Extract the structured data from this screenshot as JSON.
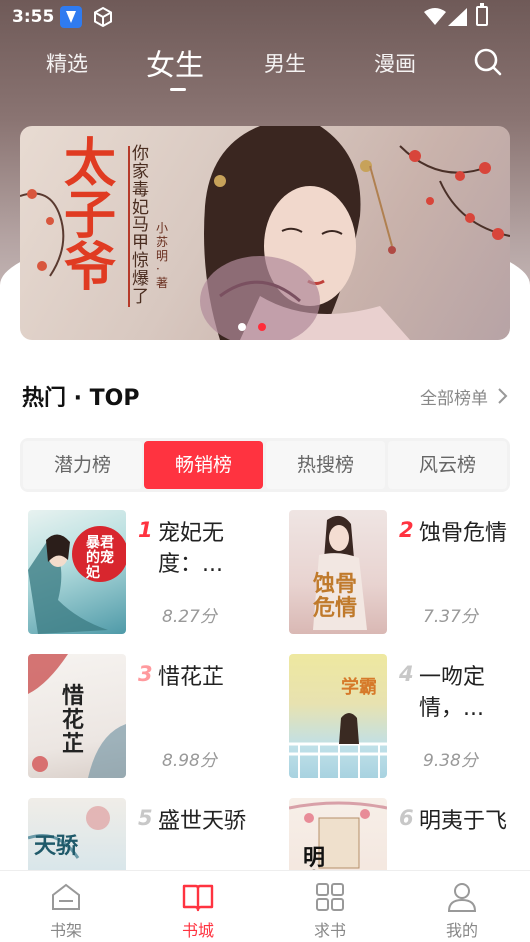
{
  "status_bar": {
    "time": "3:55"
  },
  "top_nav": {
    "tabs": [
      {
        "label": "精选"
      },
      {
        "label": "女生"
      },
      {
        "label": "男生"
      },
      {
        "label": "漫画"
      }
    ],
    "active_index": 1
  },
  "banner": {
    "title": "太子爷",
    "subtitle": "你家毒妃马甲惊爆了",
    "author": "小苏明·著",
    "page_count": 2,
    "active_page": 2
  },
  "section": {
    "title": "热门 · TOP",
    "more_label": "全部榜单"
  },
  "rank_tabs": {
    "items": [
      {
        "label": "潜力榜"
      },
      {
        "label": "畅销榜"
      },
      {
        "label": "热搜榜"
      },
      {
        "label": "风云榜"
      }
    ],
    "active_index": 1
  },
  "books": [
    {
      "rank": "1",
      "title": "宠妃无度：...",
      "score": "8.27分",
      "cover_text": "暴君的宠妃"
    },
    {
      "rank": "2",
      "title": "蚀骨危情",
      "score": "7.37分",
      "cover_text": "蚀骨危情"
    },
    {
      "rank": "3",
      "title": "惜花芷",
      "score": "8.98分",
      "cover_text": "惜花芷"
    },
    {
      "rank": "4",
      "title": "一吻定情，...",
      "score": "9.38分",
      "cover_text": "学霸"
    },
    {
      "rank": "5",
      "title": "盛世天骄",
      "score": "",
      "cover_text": "天骄"
    },
    {
      "rank": "6",
      "title": "明夷于飞",
      "score": "",
      "cover_text": "明夷"
    }
  ],
  "bottom_nav": {
    "items": [
      {
        "label": "书架",
        "icon": "bookshelf-icon"
      },
      {
        "label": "书城",
        "icon": "open-book-icon"
      },
      {
        "label": "求书",
        "icon": "grid-icon"
      },
      {
        "label": "我的",
        "icon": "person-icon"
      }
    ],
    "active_index": 1
  },
  "colors": {
    "accent": "#ff3340",
    "rank_top": "#ff3340",
    "rank_mid": "#ff9a9e",
    "rank_low": "#c8c8c8",
    "inactive_text": "#888888"
  }
}
